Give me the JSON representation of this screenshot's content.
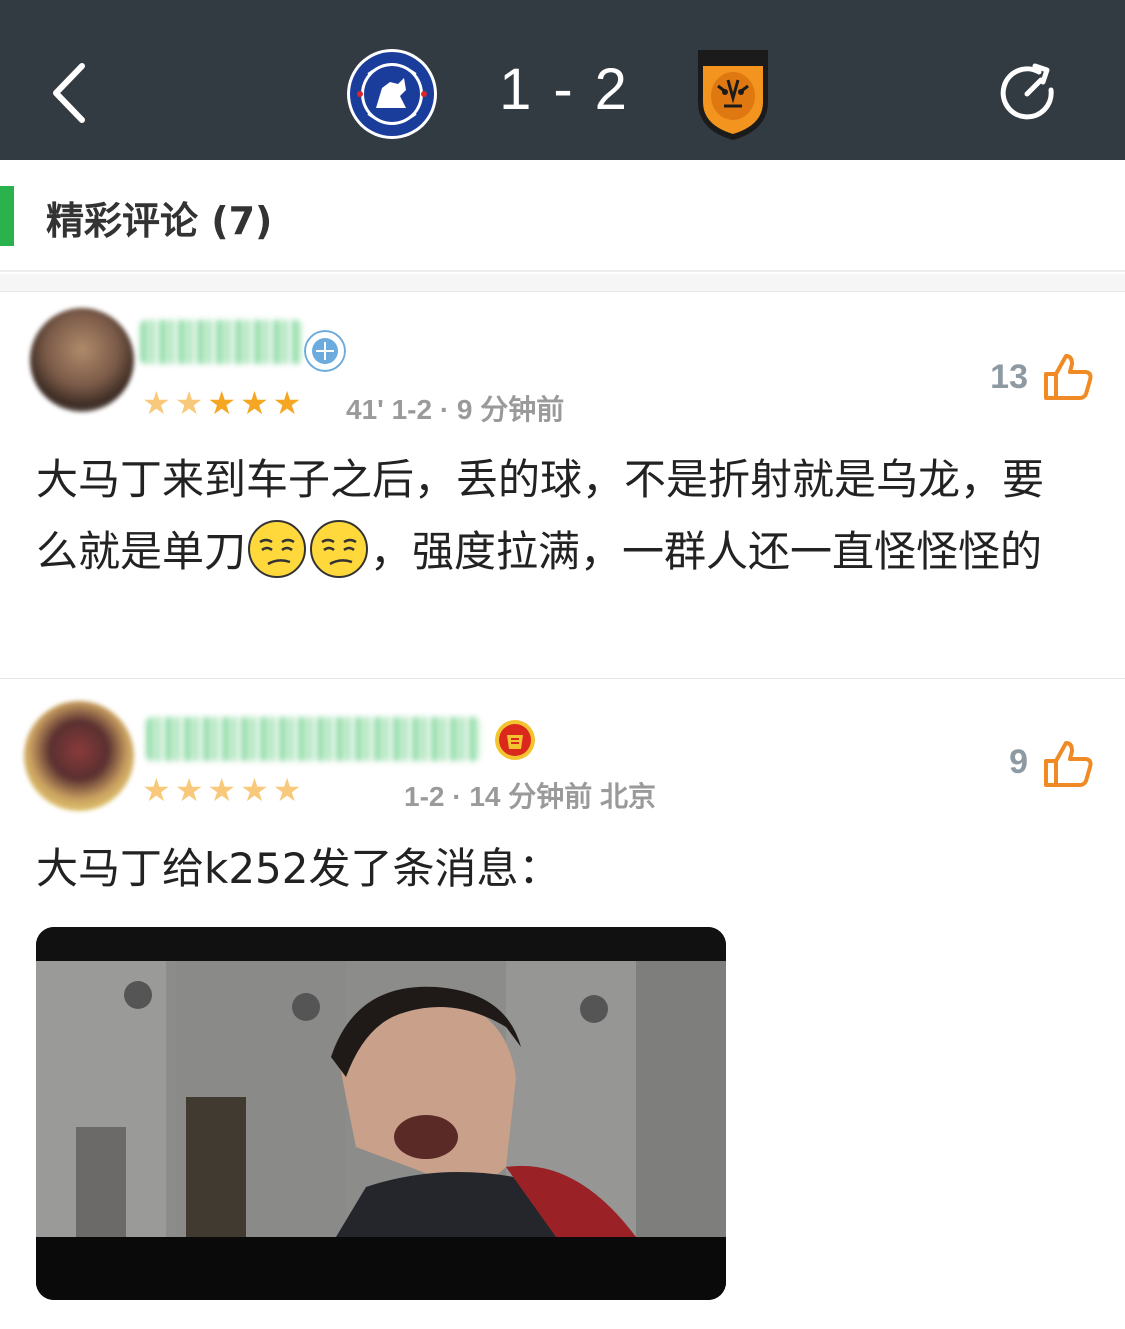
{
  "header": {
    "home_team_icon": "chelsea-crest",
    "away_team_icon": "hull-city-crest",
    "home_score": "1",
    "separator": "-",
    "away_score": "2",
    "back_icon": "chevron-left",
    "refresh_icon": "refresh"
  },
  "section": {
    "title": "精彩评论 (7)",
    "accent_color": "#2bb24c"
  },
  "comments": [
    {
      "team_badge": "manchester-city-badge",
      "rating_stars": 5,
      "meta": "41' 1-2 · 9 分钟前",
      "likes": "13",
      "text_before_emoji": "大马丁来到车子之后，丢的球，不是折射就是乌龙，要么就是单刀",
      "emoji": [
        "smirk-emoji",
        "smirk-emoji"
      ],
      "text_after_emoji": "，强度拉满，一群人还一直怪怪怪的"
    },
    {
      "team_badge": "manchester-united-badge",
      "rating_stars": 5,
      "meta": "1-2 · 14 分钟前 北京",
      "likes": "9",
      "text": "大马丁给k252发了条消息：",
      "attachment": "video-still-image"
    }
  ],
  "colors": {
    "topbar": "#323a42",
    "star": "#f5a623",
    "like_icon": "#f08a24"
  }
}
